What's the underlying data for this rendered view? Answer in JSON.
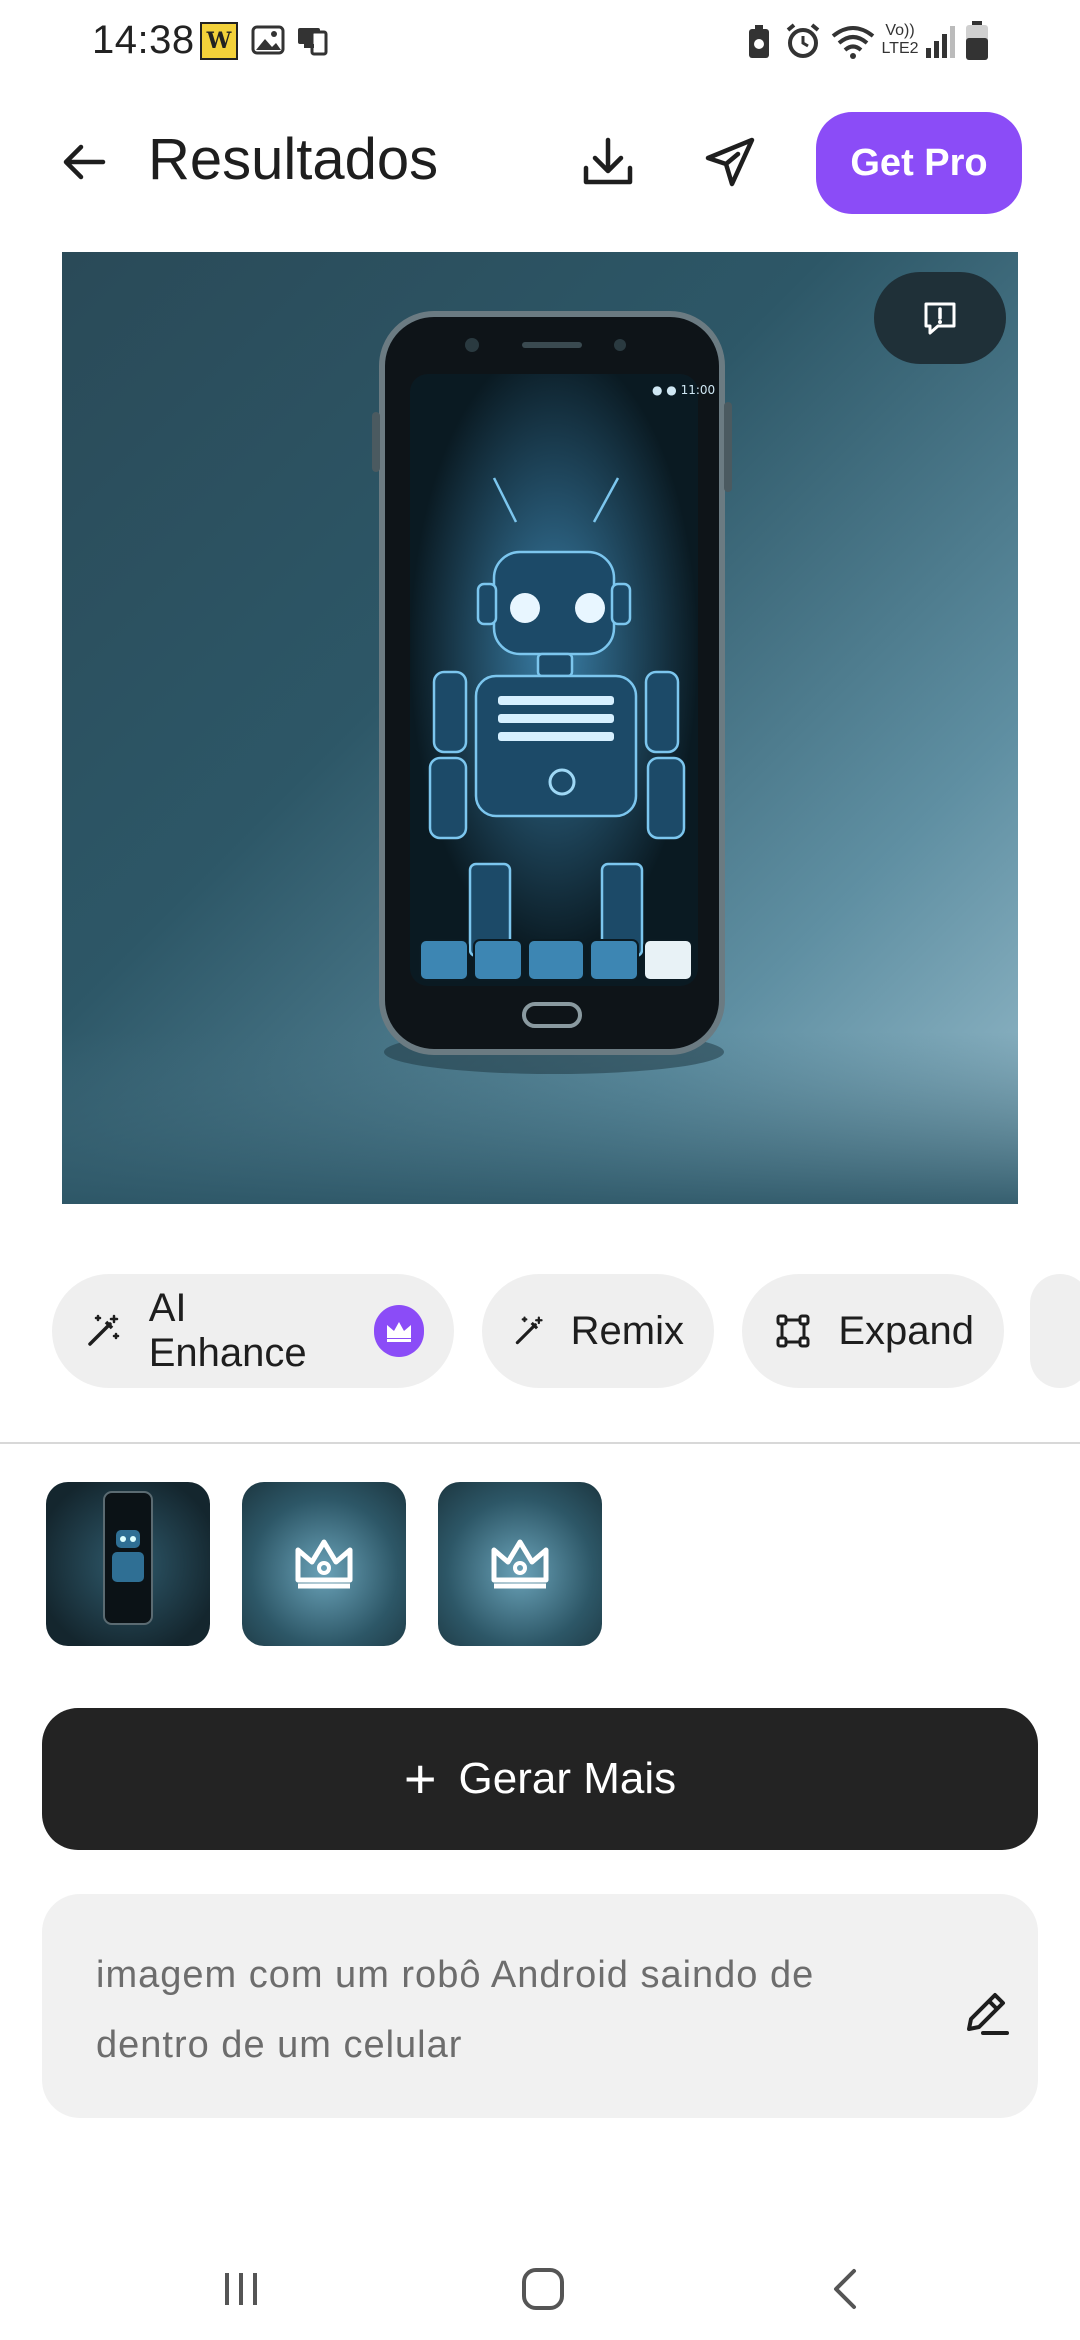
{
  "status_bar": {
    "time": "14:38",
    "left_icons": [
      "app-notification-icon",
      "image-icon",
      "devices-icon"
    ],
    "right_icons": [
      "battery-saver-icon",
      "alarm-icon",
      "wifi-icon",
      "volte-icon",
      "signal-icon",
      "battery-icon"
    ],
    "volte_label_top": "Vo))",
    "volte_label_bottom": "LTE2"
  },
  "header": {
    "title": "Resultados",
    "back_icon": "arrow-left-icon",
    "download_icon": "download-icon",
    "share_icon": "send-icon",
    "get_pro_label": "Get Pro"
  },
  "image": {
    "description_icon": "robot-phone-image",
    "report_icon": "report-icon"
  },
  "actions": [
    {
      "label": "AI Enhance",
      "icon": "magic-wand-icon",
      "premium": true
    },
    {
      "label": "Remix",
      "icon": "magic-wand-icon"
    },
    {
      "label": "Expand",
      "icon": "expand-icon"
    }
  ],
  "thumbnails": [
    {
      "selected": true,
      "locked": false
    },
    {
      "locked": true,
      "icon": "crown-icon"
    },
    {
      "locked": true,
      "icon": "crown-icon"
    }
  ],
  "generate": {
    "label": "Gerar Mais",
    "icon": "plus-icon"
  },
  "prompt": {
    "text": "imagem com um robô Android saindo de dentro de um celular",
    "edit_icon": "pencil-icon"
  },
  "colors": {
    "accent": "#8b4cf7",
    "dark_button": "#232323",
    "chip_bg": "#efefef",
    "prompt_bg": "#f1f1f1"
  }
}
